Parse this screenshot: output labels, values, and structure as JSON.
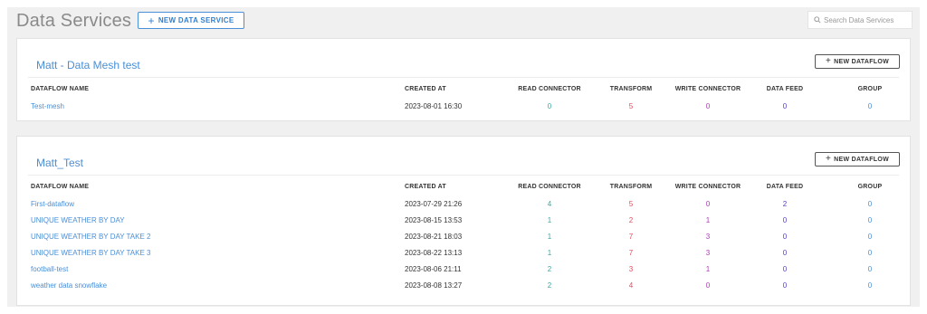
{
  "header": {
    "title": "Data Services",
    "new_service_label": "NEW DATA SERVICE",
    "search_placeholder": "Search Data Services"
  },
  "columns": {
    "name": "DATAFLOW NAME",
    "created": "CREATED AT",
    "read": "READ CONNECTOR",
    "transform": "TRANSFORM",
    "write": "WRITE CONNECTOR",
    "feed": "DATA FEED",
    "group": "GROUP"
  },
  "services": [
    {
      "title": "Matt - Data Mesh test",
      "new_flow_label": "NEW DATAFLOW",
      "rows": [
        {
          "name": "Test-mesh",
          "created": "2023-08-01 16:30",
          "read": "0",
          "transform": "5",
          "write": "0",
          "feed": "0",
          "group": "0"
        }
      ]
    },
    {
      "title": "Matt_Test",
      "new_flow_label": "NEW DATAFLOW",
      "rows": [
        {
          "name": "First-dataflow",
          "created": "2023-07-29 21:26",
          "read": "4",
          "transform": "5",
          "write": "0",
          "feed": "2",
          "group": "0"
        },
        {
          "name": "UNIQUE WEATHER BY DAY",
          "created": "2023-08-15 13:53",
          "read": "1",
          "transform": "2",
          "write": "1",
          "feed": "0",
          "group": "0"
        },
        {
          "name": "UNIQUE WEATHER BY DAY TAKE 2",
          "created": "2023-08-21 18:03",
          "read": "1",
          "transform": "7",
          "write": "3",
          "feed": "0",
          "group": "0"
        },
        {
          "name": "UNIQUE WEATHER BY DAY TAKE 3",
          "created": "2023-08-22 13:13",
          "read": "1",
          "transform": "7",
          "write": "3",
          "feed": "0",
          "group": "0"
        },
        {
          "name": "football-test",
          "created": "2023-08-06 21:11",
          "read": "2",
          "transform": "3",
          "write": "1",
          "feed": "0",
          "group": "0"
        },
        {
          "name": "weather data snowflake",
          "created": "2023-08-08 13:27",
          "read": "2",
          "transform": "4",
          "write": "0",
          "feed": "0",
          "group": "0"
        }
      ]
    }
  ]
}
